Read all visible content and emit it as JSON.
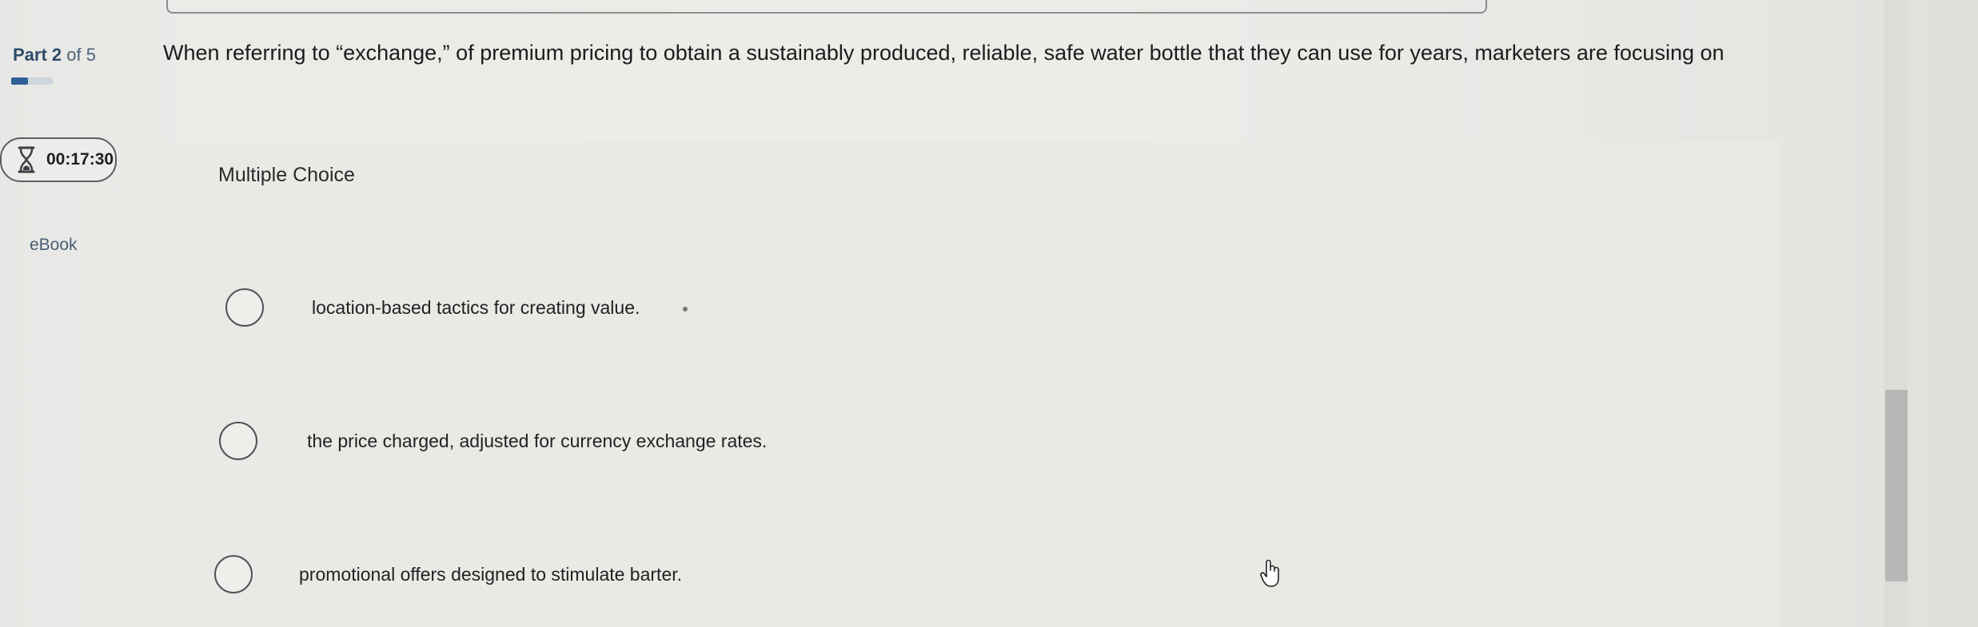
{
  "progress": {
    "part_label": "Part",
    "part_number": "2",
    "of_label": "of 5",
    "current": 2,
    "total": 5
  },
  "timer": {
    "icon": "hourglass-icon",
    "time": "00:17:30"
  },
  "ebook": {
    "label": "eBook"
  },
  "question": {
    "text": "When referring to “exchange,” of premium pricing to obtain a sustainably produced, reliable, safe water bottle that they can use for years, marketers are focusing on",
    "type_label": "Multiple Choice",
    "options": [
      {
        "text": "location-based tactics for creating value."
      },
      {
        "text": "the price charged, adjusted for currency exchange rates."
      },
      {
        "text": "promotional offers designed to stimulate barter."
      }
    ]
  },
  "colors": {
    "accent": "#2e5f96",
    "text": "#1c1c1c",
    "link": "#4a5d72",
    "background": "#ebebe8"
  }
}
